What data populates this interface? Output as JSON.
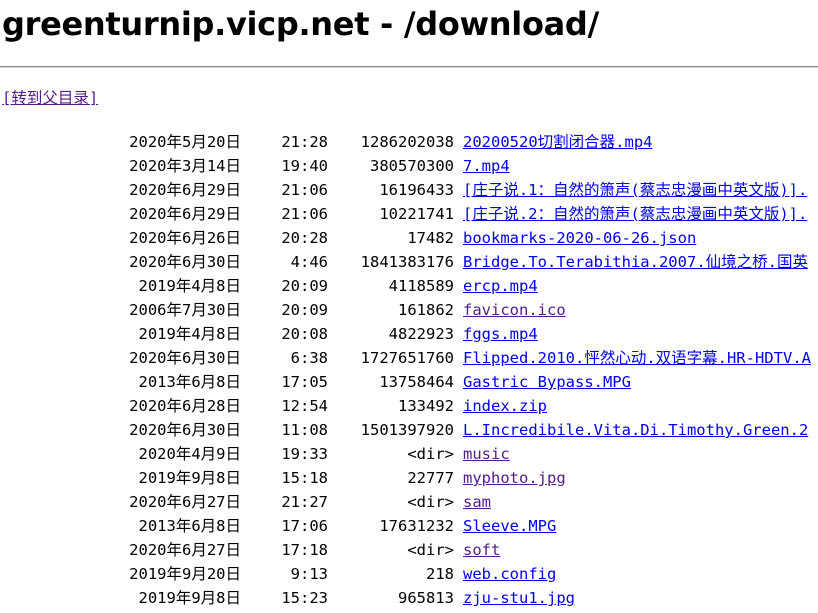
{
  "page": {
    "title": "greenturnip.vicp.net - /download/",
    "parent_link": "[转到父目录]"
  },
  "colors": {
    "link": "#0000ee",
    "visited_link": "#551a8b",
    "text": "#000000",
    "background": "#ffffff"
  },
  "entries": [
    {
      "date": "2020年5月20日",
      "time": "21:28",
      "size": "1286202038",
      "name": "20200520切割闭合器.mp4",
      "visited": false
    },
    {
      "date": "2020年3月14日",
      "time": "19:40",
      "size": "380570300",
      "name": "7.mp4",
      "visited": false
    },
    {
      "date": "2020年6月29日",
      "time": "21:06",
      "size": "16196433",
      "name": "[庄子说.1：自然的箫声(蔡志忠漫画中英文版)].",
      "visited": false
    },
    {
      "date": "2020年6月29日",
      "time": "21:06",
      "size": "10221741",
      "name": "[庄子说.2：自然的箫声(蔡志忠漫画中英文版)].",
      "visited": false
    },
    {
      "date": "2020年6月26日",
      "time": "20:28",
      "size": "17482",
      "name": "bookmarks-2020-06-26.json",
      "visited": false
    },
    {
      "date": "2020年6月30日",
      "time": "4:46",
      "size": "1841383176",
      "name": "Bridge.To.Terabithia.2007.仙境之桥.国英",
      "visited": false
    },
    {
      "date": "2019年4月8日",
      "time": "20:09",
      "size": "4118589",
      "name": "ercp.mp4",
      "visited": false
    },
    {
      "date": "2006年7月30日",
      "time": "20:09",
      "size": "161862",
      "name": "favicon.ico",
      "visited": true
    },
    {
      "date": "2019年4月8日",
      "time": "20:08",
      "size": "4822923",
      "name": "fggs.mp4",
      "visited": false
    },
    {
      "date": "2020年6月30日",
      "time": "6:38",
      "size": "1727651760",
      "name": "Flipped.2010.怦然心动.双语字幕.HR-HDTV.A",
      "visited": false
    },
    {
      "date": "2013年6月8日",
      "time": "17:05",
      "size": "13758464",
      "name": "Gastric Bypass.MPG",
      "visited": false
    },
    {
      "date": "2020年6月28日",
      "time": "12:54",
      "size": "133492",
      "name": "index.zip",
      "visited": false
    },
    {
      "date": "2020年6月30日",
      "time": "11:08",
      "size": "1501397920",
      "name": "L.Incredibile.Vita.Di.Timothy.Green.2",
      "visited": false
    },
    {
      "date": "2020年4月9日",
      "time": "19:33",
      "size": "<dir>",
      "name": "music",
      "visited": true
    },
    {
      "date": "2019年9月8日",
      "time": "15:18",
      "size": "22777",
      "name": "myphoto.jpg",
      "visited": true
    },
    {
      "date": "2020年6月27日",
      "time": "21:27",
      "size": "<dir>",
      "name": "sam",
      "visited": true
    },
    {
      "date": "2013年6月8日",
      "time": "17:06",
      "size": "17631232",
      "name": "Sleeve.MPG",
      "visited": false
    },
    {
      "date": "2020年6月27日",
      "time": "17:18",
      "size": "<dir>",
      "name": "soft",
      "visited": true
    },
    {
      "date": "2019年9月20日",
      "time": "9:13",
      "size": "218",
      "name": "web.config",
      "visited": false
    },
    {
      "date": "2019年9月8日",
      "time": "15:23",
      "size": "965813",
      "name": "zju-stu1.jpg",
      "visited": false
    }
  ]
}
